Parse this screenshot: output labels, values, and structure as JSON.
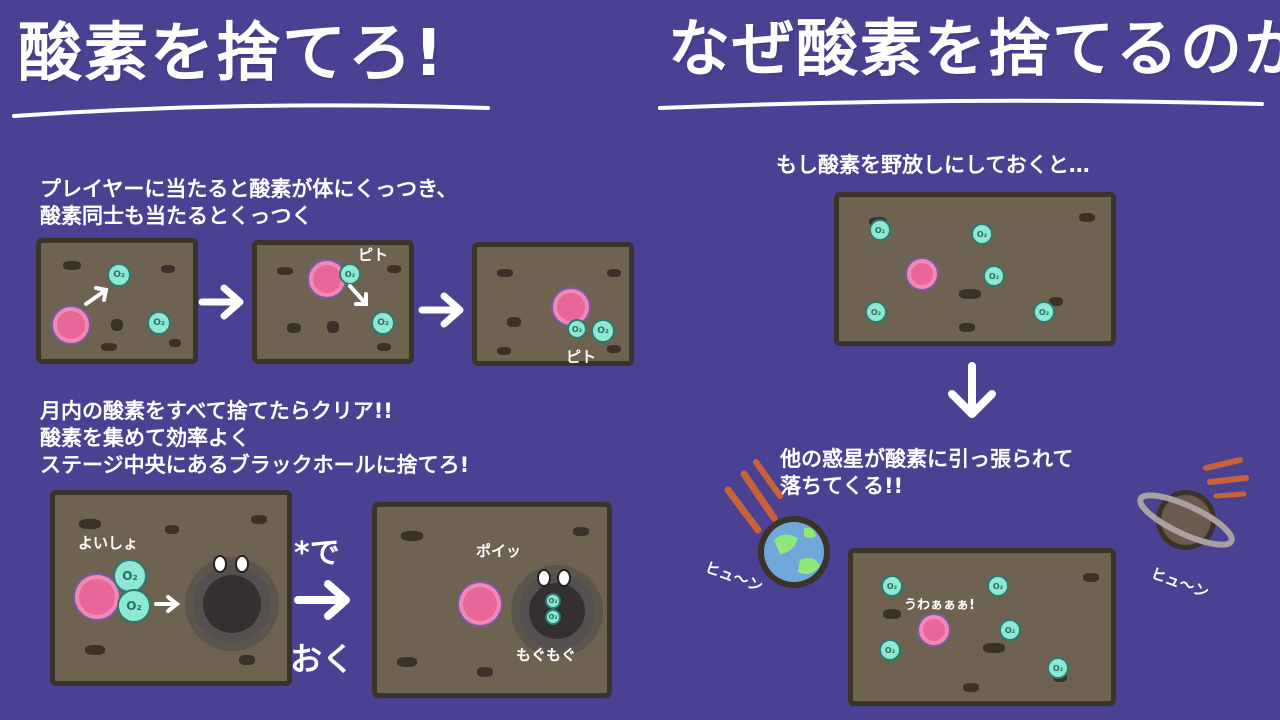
{
  "left": {
    "title": "酸素を捨てろ!",
    "caption1_line1": "プレイヤーに当たると酸素が体にくっつき、",
    "caption1_line2": "酸素同士も当たるとくっつく",
    "pito1": "ピト",
    "pito2": "ピト",
    "caption2_line1": "月内の酸素をすべて捨てたらクリア!!",
    "caption2_line2": "酸素を集めて効率よく",
    "caption2_line3": "ステージ中央にあるブラックホールに捨てろ!",
    "yoisho": "よいしょ",
    "arrow_top": "*で",
    "arrow_bottom": "おく",
    "poi": "ポイッ",
    "mogumogu": "もぐもぐ"
  },
  "right": {
    "title": "なぜ酸素を捨てるのか",
    "caption1": "もし酸素を野放しにしておくと…",
    "caption2_line1": "他の惑星が酸素に引っ張られて",
    "caption2_line2": "落ちてくる!!",
    "hyun_left": "ヒュ〜ン",
    "hyun_right": "ヒュ〜ン",
    "uwa": "うわぁぁぁ!"
  },
  "o2_label": "O₂",
  "colors": {
    "background": "#4a4193",
    "panel": "#6e6251",
    "oxygen": "#8ee8d4",
    "player": "#e8669a",
    "planet_earth_sea": "#6fa8d8",
    "planet_earth_land": "#8ee87a",
    "planet_ring": "#6b5a4e"
  }
}
